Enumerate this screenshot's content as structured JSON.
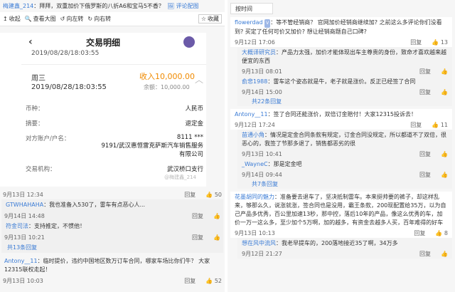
{
  "left": {
    "headline": {
      "user": "梅建鑫_214",
      "text": "：拜拜，双重加价下俄罗斯的八折A6和宝马5不香？",
      "link": "评论配图"
    },
    "toolbar": {
      "collapse": "收起",
      "zoom": "查看大图",
      "rotate_left": "向左转",
      "rotate_right": "向右转",
      "favorite": "收藏"
    },
    "screenshot": {
      "title": "交易明细",
      "date1": "2019/08/28/18:03:55",
      "weekday": "周三",
      "date2": "2019/08/28/18:03:55",
      "income": "收入10,000.00",
      "balance": "余额：10,000.00",
      "rows": [
        {
          "k": "币种：",
          "v": "人民币"
        },
        {
          "k": "摘要：",
          "v": "退定金"
        },
        {
          "k": "对方账户/户名：",
          "v": "8111 ***\n9191/武汉惠恒雷克萨斯汽车销售服务有限公司"
        },
        {
          "k": "交易机构：",
          "v": "武汉桥口支行"
        }
      ],
      "watermark": "@梅建鑫_214"
    },
    "meta1": {
      "time": "9月13日 12:34",
      "reply": "回复",
      "likes": "50"
    },
    "comments": [
      {
        "user": "GTWHAHAHA",
        "text": "：我也准备入530了，雷车有点恶心人..."
      },
      {
        "time": "9月14日 14:48",
        "reply": "回复"
      },
      {
        "user": "符金司法",
        "text": "：支持推定，不惯他！"
      },
      {
        "time": "9月13日 10:21",
        "reply": "回复"
      }
    ],
    "more": "共13条回复",
    "last": {
      "user": "Antony__11",
      "text": "：临时提价，违约中国地区数万订车合同，哪家车场比你们牛？ 大家12315联权走起！"
    },
    "meta2": {
      "time": "9月13日 10:03",
      "reply": "回复",
      "likes": "52"
    }
  },
  "right": {
    "top_label": "按时间",
    "c1": {
      "user": "flowerdad",
      "tag": "V",
      "text": "：等不管经销商？ 官网加价经销商继续加? 之前这么多评论你们没看到? 买定了任何可价又加价? 想让经销商题自己口碑?"
    },
    "c1meta": {
      "time": "9月12日 17:06",
      "reply": "回复",
      "likes": "13"
    },
    "c1subs": [
      {
        "user": "大概译研究员",
        "text": "：产品力太强，加价才能体现出车主尊贵的身份，致命才喜欢越来越便宜的东西"
      },
      {
        "time": "9月13日 08:01",
        "reply": "回复"
      },
      {
        "user": "俞悲1988",
        "text": "：雷车这个姿态就是牛，老子就是涨价。反正已经签了合同"
      },
      {
        "time": "9月14日 15:00",
        "reply": "回复"
      }
    ],
    "c1more": "共22条回复",
    "c2": {
      "user": "Antony__11",
      "text": "：签了合同还能涨价，双倍订金赔付！大家12315投诉去！"
    },
    "c2meta": {
      "time": "9月12日 17:24",
      "reply": "回复",
      "likes": "11"
    },
    "c2subs": [
      {
        "user": "苗通小角",
        "text": "：情况是定金合同条款有规定，订金合同没规定，所以都道不了双倍，很恶心的，我签了节那多退了，销售都恶劣的很"
      },
      {
        "time": "9月13日 10:41",
        "reply": "回复"
      },
      {
        "user": "_WayneC",
        "text": "：那是定金吧"
      },
      {
        "time": "9月14日 09:44",
        "reply": "回复"
      }
    ],
    "c2more": "共7条回复",
    "c3": {
      "user": "花墨胡同的魅力",
      "text": "：准备要去退车了，坚决抵制雷车。本来挺帅要的裤子，却这样乱来，够那么久，说涨就涨，签合同也是没用，霸王条款，200现配置给35万，以为自己产品多优秀，百公里加速13秒，那中控，落后10年的产品，像这么优秀的车，加价一万一这么多，至少加个5万啊，加的越多，有资金去越多人买，百年难得的好车"
    },
    "c3meta": {
      "time": "9月13日 10:13",
      "reply": "回复",
      "likes": "8"
    },
    "c3subs": [
      {
        "user": "想在风中流风",
        "text": "：我老早提车的，200落地接近35了啊，34万多"
      },
      {
        "time": "9月12日 21:27",
        "reply": "回复"
      }
    ]
  }
}
